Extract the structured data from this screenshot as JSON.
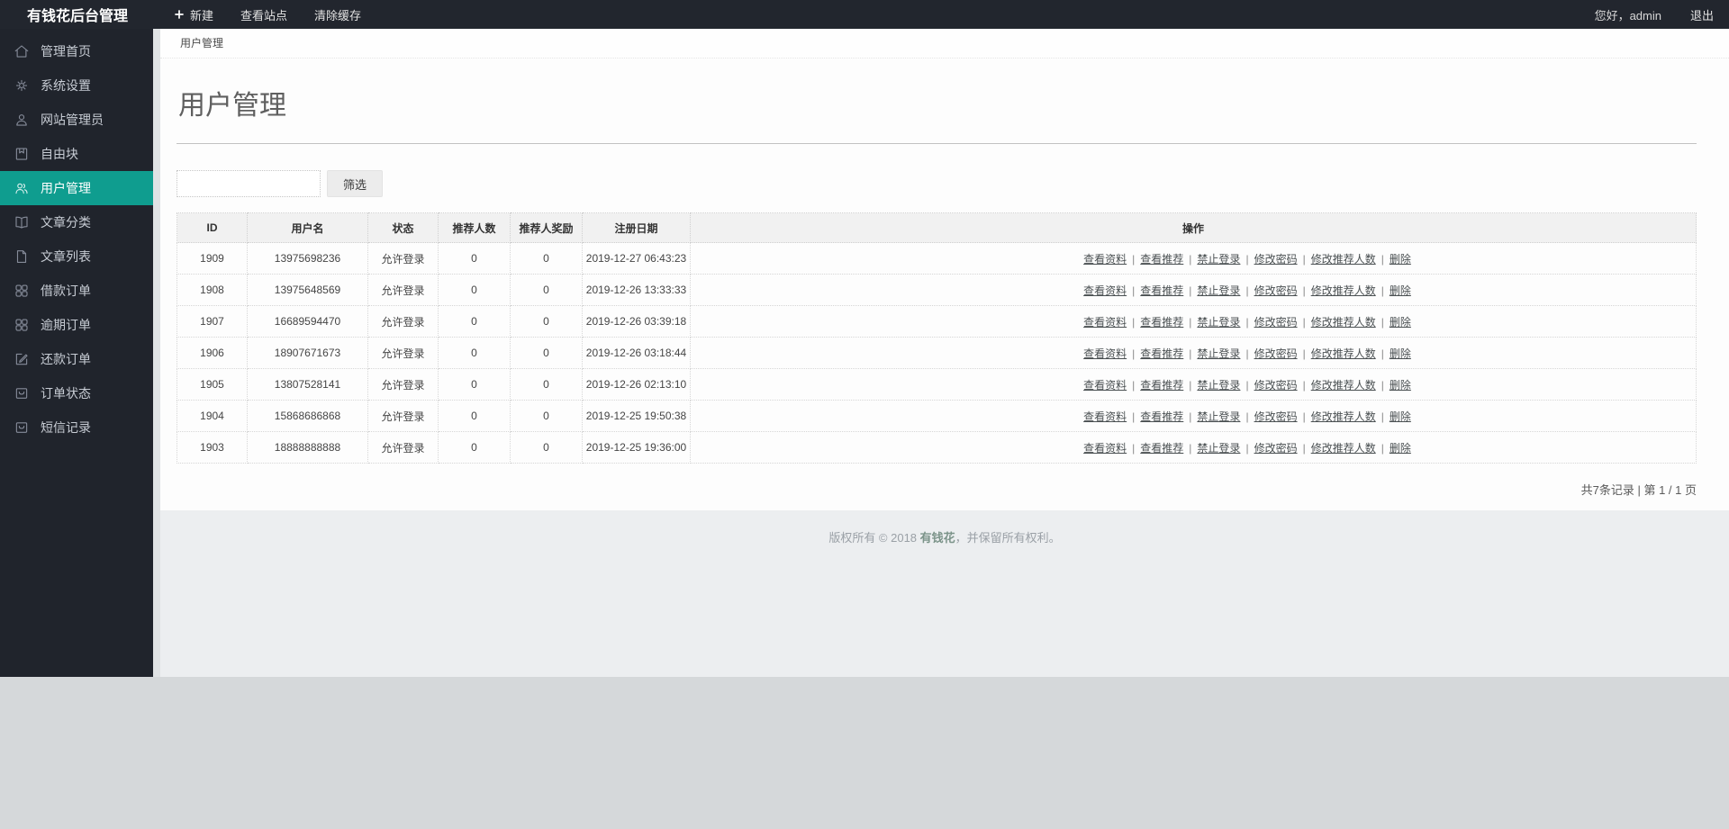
{
  "topbar": {
    "brand": "有钱花后台管理",
    "menu": [
      {
        "label": "新建",
        "icon": "plus-icon"
      },
      {
        "label": "查看站点"
      },
      {
        "label": "清除缓存"
      }
    ],
    "greeting": "您好，admin",
    "logout": "退出"
  },
  "sidebar": {
    "items": [
      {
        "label": "管理首页",
        "icon": "home-icon",
        "active": false
      },
      {
        "label": "系统设置",
        "icon": "gear-icon",
        "active": false
      },
      {
        "label": "网站管理员",
        "icon": "user-icon",
        "active": false
      },
      {
        "label": "自由块",
        "icon": "block-icon",
        "active": false
      },
      {
        "label": "用户管理",
        "icon": "users-icon",
        "active": true
      },
      {
        "label": "文章分类",
        "icon": "book-icon",
        "active": false
      },
      {
        "label": "文章列表",
        "icon": "file-icon",
        "active": false
      },
      {
        "label": "借款订单",
        "icon": "grid-icon",
        "active": false
      },
      {
        "label": "逾期订单",
        "icon": "grid-icon",
        "active": false
      },
      {
        "label": "还款订单",
        "icon": "edit-icon",
        "active": false
      },
      {
        "label": "订单状态",
        "icon": "tray-icon",
        "active": false
      },
      {
        "label": "短信记录",
        "icon": "tray-icon",
        "active": false
      }
    ]
  },
  "breadcrumb": "用户管理",
  "page": {
    "title": "用户管理"
  },
  "filter": {
    "input_value": "",
    "button_label": "筛选"
  },
  "table": {
    "headers": [
      "ID",
      "用户名",
      "状态",
      "推荐人数",
      "推荐人奖励",
      "注册日期",
      "操作"
    ],
    "actions": [
      "查看资料",
      "查看推荐",
      "禁止登录",
      "修改密码",
      "修改推荐人数",
      "删除"
    ],
    "action_separator": "|",
    "rows": [
      {
        "id": "1909",
        "username": "13975698236",
        "status": "允许登录",
        "referrals": "0",
        "referral_reward": "0",
        "reg_date": "2019-12-27 06:43:23"
      },
      {
        "id": "1908",
        "username": "13975648569",
        "status": "允许登录",
        "referrals": "0",
        "referral_reward": "0",
        "reg_date": "2019-12-26 13:33:33"
      },
      {
        "id": "1907",
        "username": "16689594470",
        "status": "允许登录",
        "referrals": "0",
        "referral_reward": "0",
        "reg_date": "2019-12-26 03:39:18"
      },
      {
        "id": "1906",
        "username": "18907671673",
        "status": "允许登录",
        "referrals": "0",
        "referral_reward": "0",
        "reg_date": "2019-12-26 03:18:44"
      },
      {
        "id": "1905",
        "username": "13807528141",
        "status": "允许登录",
        "referrals": "0",
        "referral_reward": "0",
        "reg_date": "2019-12-26 02:13:10"
      },
      {
        "id": "1904",
        "username": "15868686868",
        "status": "允许登录",
        "referrals": "0",
        "referral_reward": "0",
        "reg_date": "2019-12-25 19:50:38"
      },
      {
        "id": "1903",
        "username": "18888888888",
        "status": "允许登录",
        "referrals": "0",
        "referral_reward": "0",
        "reg_date": "2019-12-25 19:36:00"
      }
    ]
  },
  "pagination": {
    "text": "共7条记录 | 第 1 / 1 页"
  },
  "footer": {
    "prefix": "版权所有 © 2018 ",
    "brand": "有钱花",
    "suffix": "，并保留所有权利。"
  },
  "colors": {
    "accent": "#0f9d8f",
    "topbar_bg": "#22262e",
    "sidebar_bg": "#20242c"
  }
}
